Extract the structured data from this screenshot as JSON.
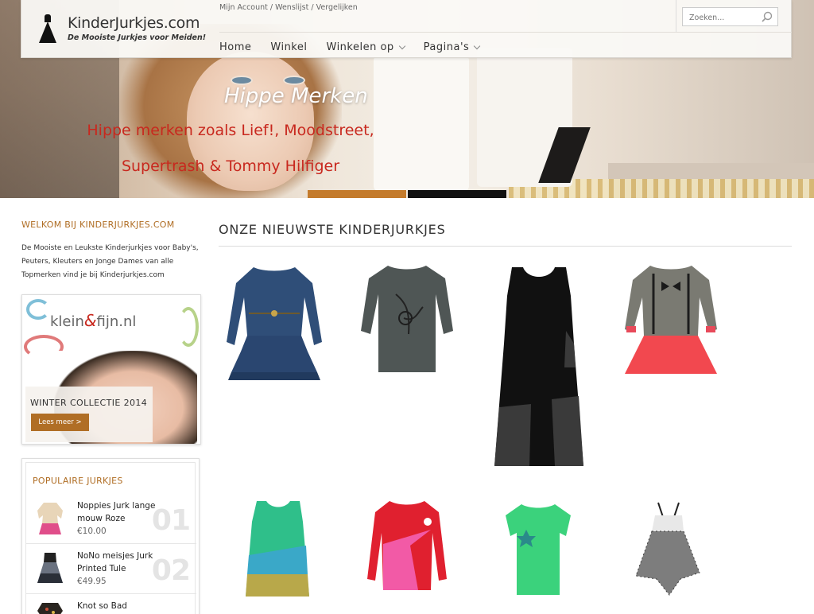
{
  "header": {
    "logo_name": "KinderJurkjes.com",
    "logo_tagline": "De Mooiste Jurkjes voor Meiden!",
    "top_links": "Mijn Account / Wenslijst / Vergelijken",
    "search_placeholder": "Zoeken..."
  },
  "nav": [
    {
      "label": "Home",
      "has_dropdown": false
    },
    {
      "label": "Winkel",
      "has_dropdown": false
    },
    {
      "label": "Winkelen op",
      "has_dropdown": true
    },
    {
      "label": "Pagina's",
      "has_dropdown": true
    }
  ],
  "hero": {
    "title": "Hippe Merken",
    "subtitle_line1": "Hippe merken zoals Lief!, Moodstreet,",
    "subtitle_line2": "Supertrash & Tommy Hilfiger",
    "accent_color": "#c47b2c"
  },
  "sidebar": {
    "welcome_title": "WELKOM BIJ KINDERJURKJES.COM",
    "welcome_text": "De Mooiste en Leukste Kinderjurkjes voor Baby's, Peuters, Kleuters en Jonge Dames van alle Topmerken vind je bij Kinderjurkjes.com",
    "promo": {
      "logo_left": "klein",
      "logo_amp": "&",
      "logo_right": "fijn.nl",
      "caption": "WINTER COLLECTIE 2014",
      "button": "Lees meer >"
    },
    "popular_title": "POPULAIRE JURKJES",
    "popular": [
      {
        "name": "Noppies Jurk lange mouw Roze",
        "price": "€10.00",
        "num": "01"
      },
      {
        "name": "NoNo meisjes Jurk Printed Tule",
        "price": "€49.95",
        "num": "02"
      },
      {
        "name": "Knot so Bad",
        "price": "",
        "num": ""
      }
    ]
  },
  "main": {
    "title": "ONZE NIEUWSTE KINDERJURKJES"
  },
  "colors": {
    "accent": "#b06e25",
    "hero_text_red": "#c8281e"
  }
}
